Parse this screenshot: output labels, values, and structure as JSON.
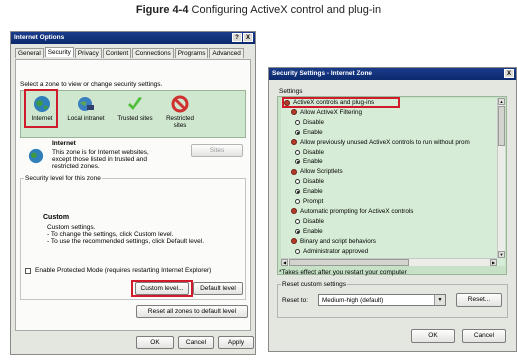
{
  "caption": {
    "figure_label": "Figure 4-4",
    "title": "Configuring ActiveX control and plug-in"
  },
  "internet_options": {
    "title": "Internet Options",
    "title_buttons": [
      "?",
      "X"
    ],
    "tabs": [
      "General",
      "Security",
      "Privacy",
      "Content",
      "Connections",
      "Programs",
      "Advanced"
    ],
    "active_tab": "Security",
    "select_zone_text": "Select a zone to view or change security settings.",
    "zones": [
      {
        "label": "Internet",
        "icon": "globe-icon"
      },
      {
        "label": "Local intranet",
        "icon": "intranet-icon"
      },
      {
        "label": "Trusted sites",
        "icon": "checkmark-icon"
      },
      {
        "label": "Restricted sites",
        "icon": "no-entry-icon"
      }
    ],
    "zone_title": "Internet",
    "zone_desc": [
      "This zone is for Internet websites,",
      "except those listed in trusted and",
      "restricted zones."
    ],
    "sites_button": "Sites",
    "security_level_label": "Security level for this zone",
    "custom_title": "Custom",
    "custom_lines": [
      "Custom settings.",
      "- To change the settings, click Custom level.",
      "- To use the recommended settings, click Default level."
    ],
    "protected_mode": "Enable Protected Mode (requires restarting Internet Explorer)",
    "custom_level_button": "Custom level...",
    "default_level_button": "Default level",
    "reset_all_button": "Reset all zones to default level",
    "ok": "OK",
    "cancel": "Cancel",
    "apply": "Apply",
    "accent_red": "#d11a2a"
  },
  "security_settings": {
    "title": "Security Settings - Internet Zone",
    "title_close": "X",
    "settings_label": "Settings",
    "items": [
      {
        "kind": "header",
        "text": "ActiveX controls and plug-ins"
      },
      {
        "kind": "header",
        "text": "Allow ActiveX Filtering"
      },
      {
        "kind": "radio",
        "text": "Disable",
        "checked": false
      },
      {
        "kind": "radio",
        "text": "Enable",
        "checked": true
      },
      {
        "kind": "header",
        "text": "Allow previously unused ActiveX controls to run without prom"
      },
      {
        "kind": "radio",
        "text": "Disable",
        "checked": false
      },
      {
        "kind": "radio",
        "text": "Enable",
        "checked": true
      },
      {
        "kind": "header",
        "text": "Allow Scriptlets"
      },
      {
        "kind": "radio",
        "text": "Disable",
        "checked": false
      },
      {
        "kind": "radio",
        "text": "Enable",
        "checked": true
      },
      {
        "kind": "radio",
        "text": "Prompt",
        "checked": false
      },
      {
        "kind": "header",
        "text": "Automatic prompting for ActiveX controls"
      },
      {
        "kind": "radio",
        "text": "Disable",
        "checked": false
      },
      {
        "kind": "radio",
        "text": "Enable",
        "checked": true
      },
      {
        "kind": "header",
        "text": "Binary and script behaviors"
      },
      {
        "kind": "radio",
        "text": "Administrator approved",
        "checked": false
      }
    ],
    "restart_note": "*Takes effect after you restart your computer",
    "reset_custom_label": "Reset custom settings",
    "reset_to_label": "Reset to:",
    "reset_to_value": "Medium-high (default)",
    "reset_button": "Reset...",
    "ok": "OK",
    "cancel": "Cancel"
  }
}
